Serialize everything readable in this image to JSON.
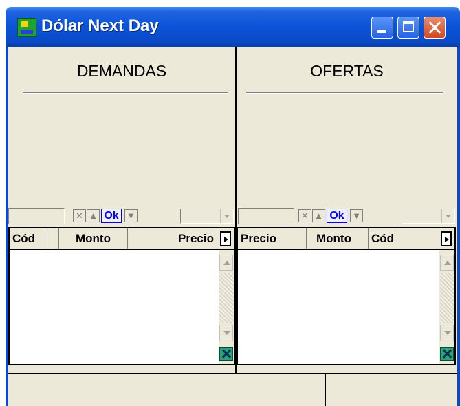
{
  "window": {
    "title": "Dólar Next Day",
    "icon": "app-icon",
    "controls": [
      "minimize-icon",
      "maximize-icon",
      "close-icon"
    ]
  },
  "demandas": {
    "heading": "DEMANDAS",
    "toolbar": {
      "ok_label": "Ok",
      "icons": [
        "clear-icon",
        "arrow-up-icon",
        "ok-button",
        "arrow-down-icon",
        "dropdown-icon"
      ]
    },
    "columns": [
      "Cód",
      "Monto",
      "Precio"
    ],
    "rows": []
  },
  "ofertas": {
    "heading": "OFERTAS",
    "toolbar": {
      "ok_label": "Ok",
      "icons": [
        "clear-icon",
        "arrow-up-icon",
        "ok-button",
        "arrow-down-icon",
        "dropdown-icon"
      ]
    },
    "columns": [
      "Precio",
      "Monto",
      "Cód"
    ],
    "rows": []
  },
  "status_bar": {
    "left": "",
    "right": ""
  }
}
